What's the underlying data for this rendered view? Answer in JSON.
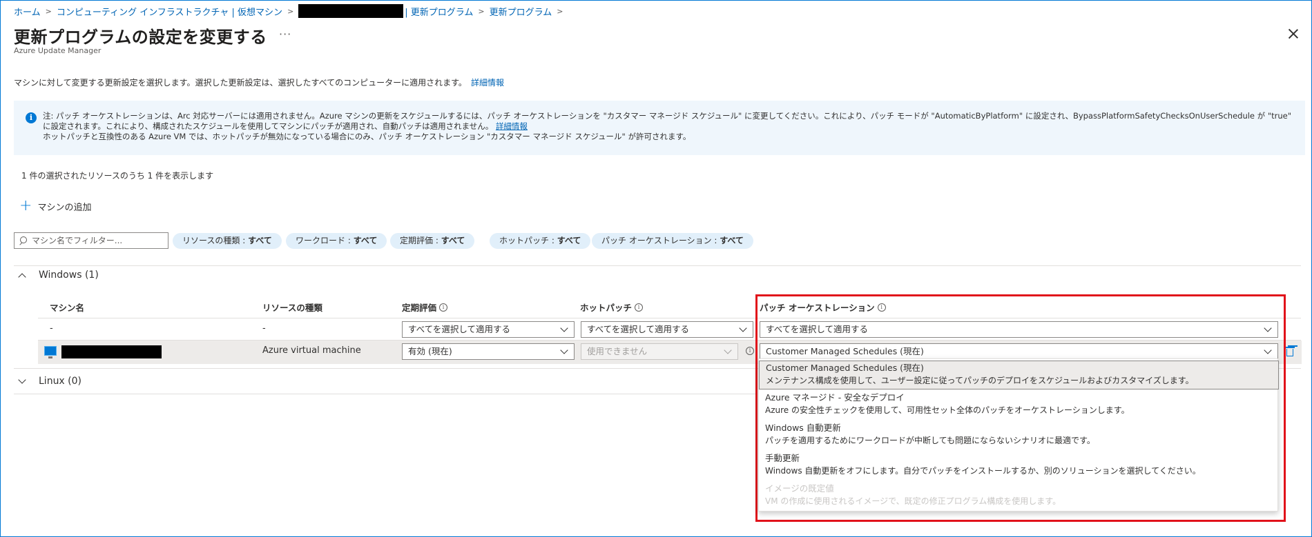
{
  "breadcrumb": {
    "home": "ホーム",
    "compute": "コンピューティング インフラストラクチャ | 仮想マシン",
    "updates_suffix": "| 更新プログラム",
    "updates": "更新プログラム"
  },
  "header": {
    "title": "更新プログラムの設定を変更する",
    "more": "···",
    "subtitle": "Azure Update Manager"
  },
  "intro": {
    "text": "マシンに対して変更する更新設定を選択します。選択した更新設定は、選択したすべてのコンピューターに適用されます。",
    "link": "詳細情報"
  },
  "info": {
    "line1": "注: パッチ オーケストレーションは、Arc 対応サーバーには適用されません。Azure マシンの更新をスケジュールするには、パッチ オーケストレーションを \"カスタマー マネージド スケジュール\" に変更してください。これにより、パッチ モードが \"AutomaticByPlatform\" に設定され、BypassPlatformSafetyChecksOnUserSchedule が \"true\" に設定されます。これにより、構成されたスケジュールを使用してマシンにパッチが適用され、自動パッチは適用されません。",
    "link": "詳細情報",
    "line2": "ホットパッチと互換性のある Azure VM では、ホットパッチが無効になっている場合にのみ、パッチ オーケストレーション \"カスタマー マネージド スケジュール\" が許可されます。"
  },
  "count_text": "1 件の選択されたリソースのうち 1 件を表示します",
  "add_machine": "マシンの追加",
  "filter": {
    "placeholder": "マシン名でフィルター..."
  },
  "pills": [
    {
      "label": "リソースの種類 : ",
      "value": "すべて"
    },
    {
      "label": "ワークロード : ",
      "value": "すべて"
    },
    {
      "label": "定期評価 : ",
      "value": "すべて"
    },
    {
      "label": "ホットパッチ : ",
      "value": "すべて"
    },
    {
      "label": "パッチ オーケストレーション : ",
      "value": "すべて"
    }
  ],
  "groups": {
    "windows": "Windows (1)",
    "linux": "Linux (0)"
  },
  "columns": {
    "name": "マシン名",
    "type": "リソースの種類",
    "assessment": "定期評価",
    "hotpatch": "ホットパッチ",
    "orchestration": "パッチ オーケストレーション"
  },
  "bulk_row": {
    "name": "-",
    "type": "-",
    "assessment": "すべてを選択して適用する",
    "hotpatch": "すべてを選択して適用する",
    "orchestration": "すべてを選択して適用する"
  },
  "vm_row": {
    "type": "Azure virtual machine",
    "assessment": "有効 (現在)",
    "hotpatch": "使用できません",
    "orchestration": "Customer Managed Schedules (現在)"
  },
  "menu": [
    {
      "title": "Customer Managed Schedules (現在)",
      "desc": "メンテナンス構成を使用して、ユーザー設定に従ってパッチのデプロイをスケジュールおよびカスタマイズします。",
      "state": "selected"
    },
    {
      "title": "Azure マネージド - 安全なデプロイ",
      "desc": "Azure の安全性チェックを使用して、可用性セット全体のパッチをオーケストレーションします。",
      "state": "normal"
    },
    {
      "title": "Windows 自動更新",
      "desc": "パッチを適用するためにワークロードが中断しても問題にならないシナリオに最適です。",
      "state": "normal"
    },
    {
      "title": "手動更新",
      "desc": "Windows 自動更新をオフにします。自分でパッチをインストールするか、別のソリューションを選択してください。",
      "state": "normal"
    },
    {
      "title": "イメージの既定値",
      "desc": "VM の作成に使用されるイメージで、既定の修正プログラム構成を使用します。",
      "state": "disabled"
    }
  ],
  "colors": {
    "accent": "#0078d4",
    "highlight": "#e1121a",
    "info_bg": "#eff6fc",
    "pill_bg": "#e1effa"
  }
}
